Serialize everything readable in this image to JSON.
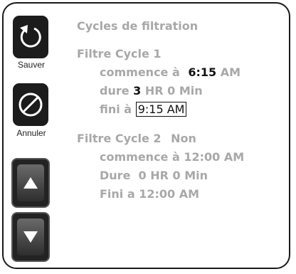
{
  "buttons": {
    "save_label": "Sauver",
    "cancel_label": "Annuler"
  },
  "icons": {
    "save": "undo-arrow-icon",
    "cancel": "prohibited-icon",
    "up": "arrow-up-icon",
    "down": "arrow-down-icon"
  },
  "title": "Cycles de filtration",
  "cycle1": {
    "heading": "Filtre Cycle 1",
    "start_label": "commence à",
    "start_time": "6:15",
    "start_ampm": "AM",
    "duration_label": "dure",
    "duration_hr": "3",
    "duration_rest": "HR 0 Min",
    "end_label": "fini à",
    "end_time": "9:15 AM"
  },
  "cycle2": {
    "heading": "Filtre Cycle 2",
    "state": "Non",
    "start": "commence à 12:00 AM",
    "duration": "Dure  0 HR 0 Min",
    "end": "Fini a 12:00 AM"
  },
  "colors": {
    "text_dim": "#a8a8a8",
    "text_active": "#111111",
    "button_bg": "#1c1c1c"
  }
}
